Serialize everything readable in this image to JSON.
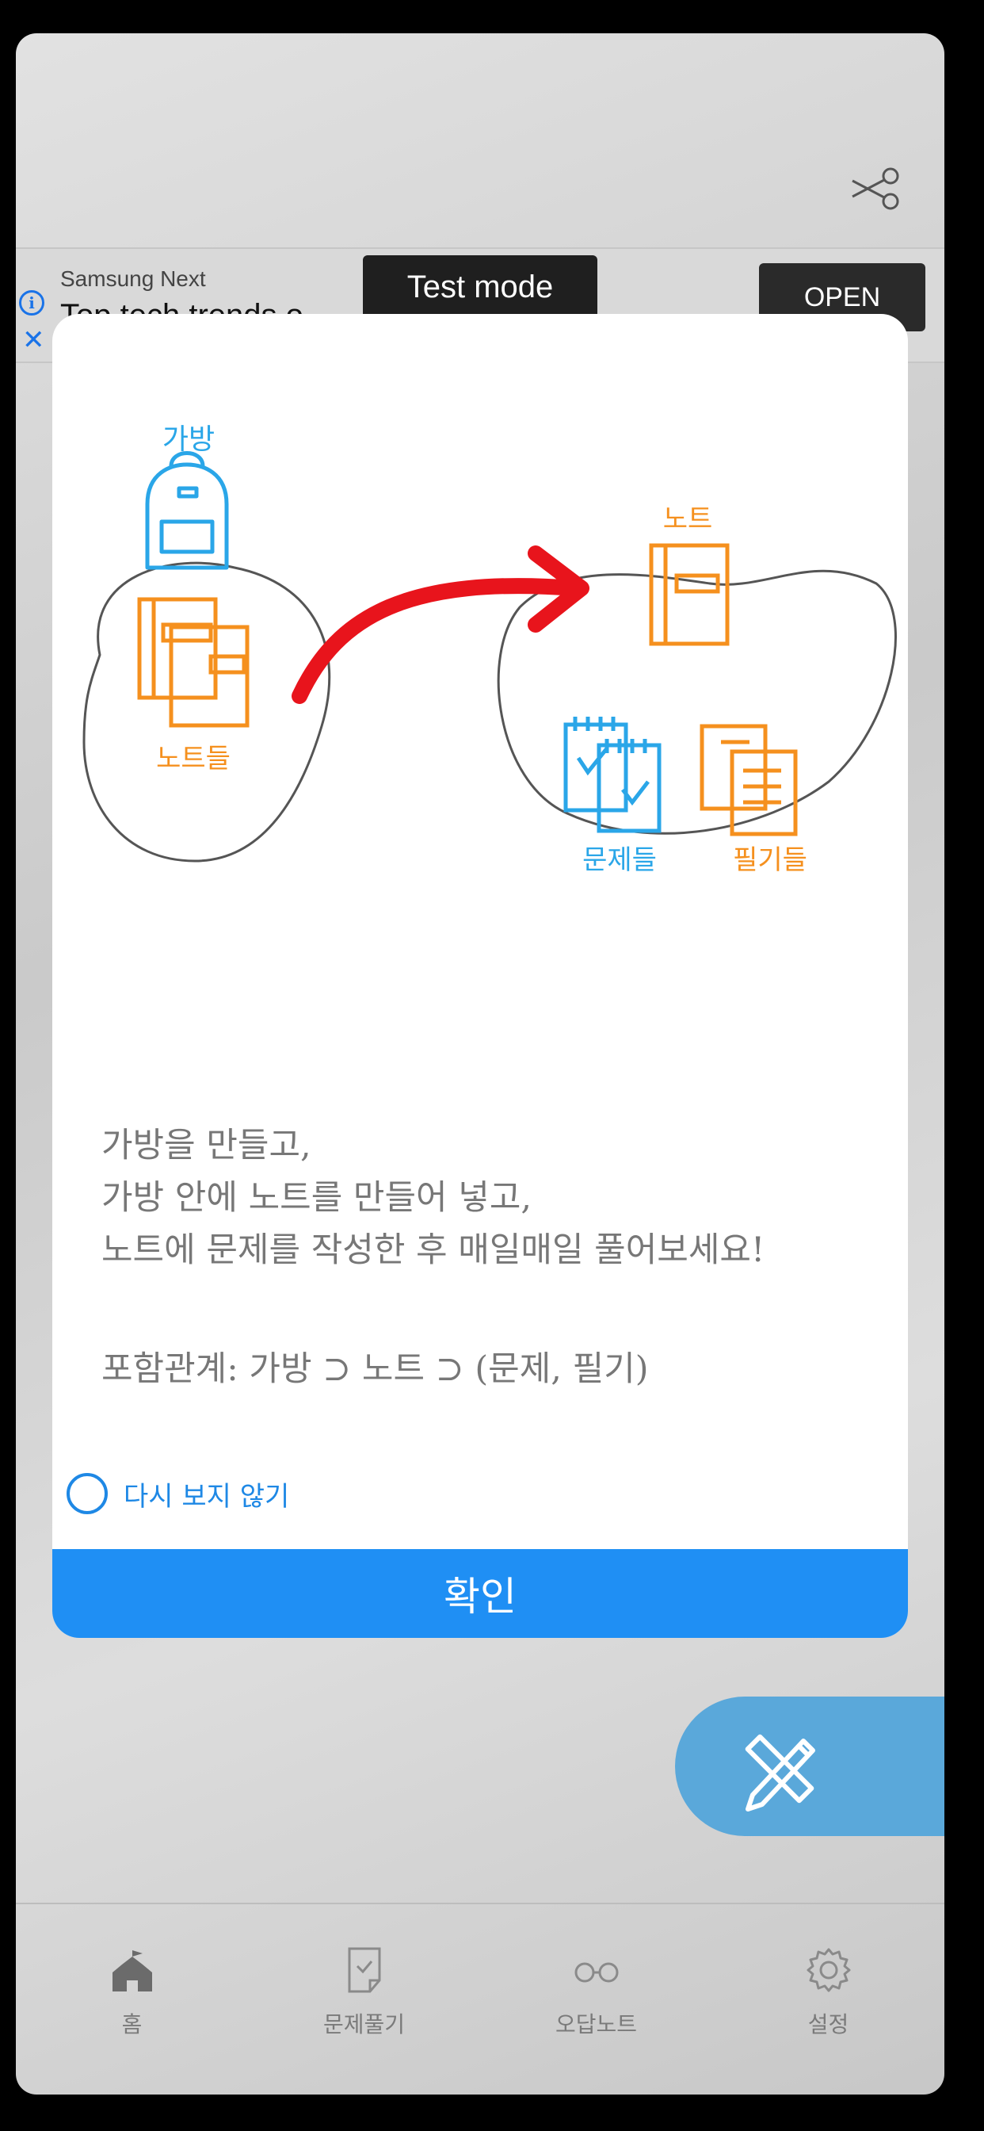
{
  "ad": {
    "advertiser": "Samsung Next",
    "headline": "Top tech trends o",
    "test_mode": "Test mode",
    "cta": "OPEN"
  },
  "modal": {
    "illustration": {
      "bag_label": "가방",
      "notes_label": "노트들",
      "note_label": "노트",
      "questions_label": "문제들",
      "memos_label": "필기들"
    },
    "lines": [
      "가방을 만들고,",
      "가방 안에 노트를 만들어 넣고,",
      "노트에 문제를 작성한 후 매일매일 풀어보세요!"
    ],
    "relation": "포함관계: 가방 ⊃ 노트 ⊃ (문제, 필기)",
    "dont_show_again": "다시 보지 않기",
    "confirm": "확인"
  },
  "nav": {
    "items": [
      {
        "label": "홈",
        "icon": "school-icon"
      },
      {
        "label": "문제풀기",
        "icon": "quiz-document-icon"
      },
      {
        "label": "오답노트",
        "icon": "glasses-icon"
      },
      {
        "label": "설정",
        "icon": "gear-icon"
      }
    ]
  },
  "colors": {
    "accent": "#1f8ff4",
    "fab": "#5aa8da",
    "orange": "#f5901e",
    "sky": "#2aa6e8",
    "arrow_red": "#e8141c"
  }
}
